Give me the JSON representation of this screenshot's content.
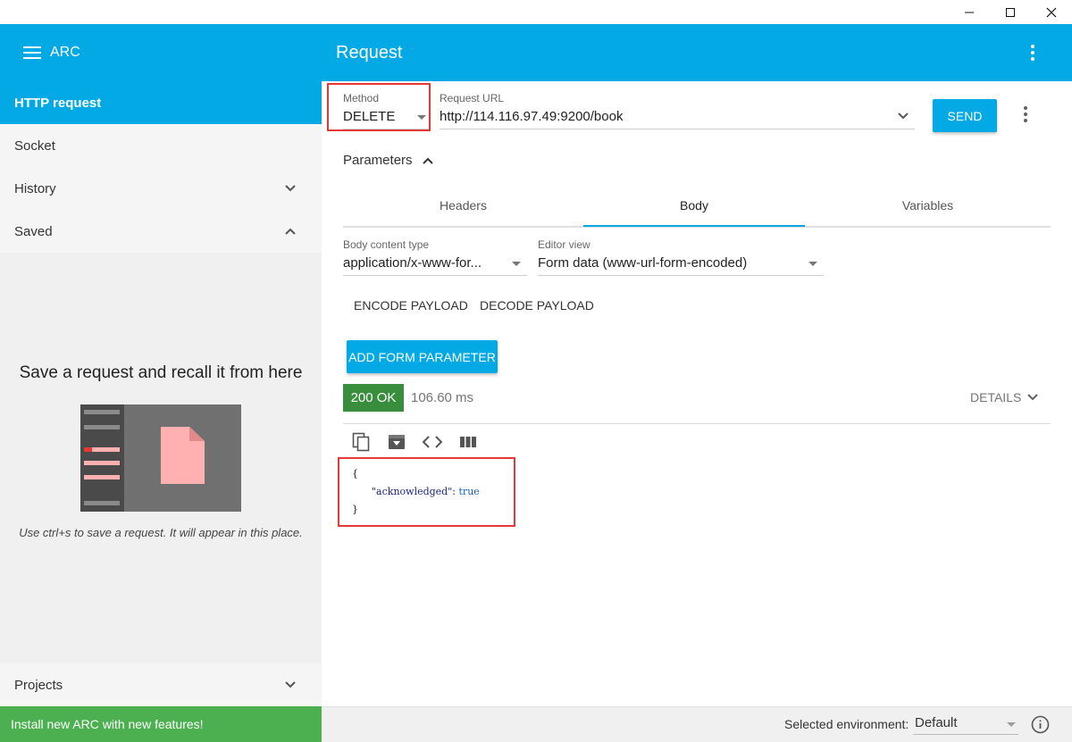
{
  "window": {
    "controls": [
      "minimize-icon",
      "maximize-icon",
      "close-icon"
    ]
  },
  "app": {
    "name": "ARC",
    "page_title": "Request"
  },
  "sidebar": {
    "items": [
      {
        "label": "HTTP request",
        "active": true
      },
      {
        "label": "Socket"
      },
      {
        "label": "History",
        "chevron": "chevron-down-icon"
      },
      {
        "label": "Saved",
        "chevron": "chevron-up-icon"
      }
    ],
    "saved_empty": {
      "title": "Save a request and recall it from here",
      "hint": "Use ctrl+s to save a request. It will appear in this place."
    },
    "projects_label": "Projects",
    "install_banner": "Install new ARC with new features!"
  },
  "request": {
    "method_label": "Method",
    "method_value": "DELETE",
    "url_label": "Request URL",
    "url_value": "http://114.116.97.49:9200/book",
    "send_label": "SEND",
    "parameters_label": "Parameters",
    "tabs": [
      {
        "label": "Headers"
      },
      {
        "label": "Body",
        "active": true
      },
      {
        "label": "Variables"
      }
    ],
    "body_content_type_label": "Body content type",
    "body_content_type_value": "application/x-www-for...",
    "editor_view_label": "Editor view",
    "editor_view_value": "Form data (www-url-form-encoded)",
    "encode_payload": "ENCODE PAYLOAD",
    "decode_payload": "DECODE PAYLOAD",
    "add_form_parameter": "ADD FORM PARAMETER"
  },
  "response": {
    "status": "200 OK",
    "time": "106.60 ms",
    "details_label": "DETAILS",
    "actions": [
      "copy-icon",
      "save-icon",
      "code-icon",
      "columns-icon"
    ],
    "json": {
      "open": "{",
      "key": "\"acknowledged\"",
      "colon": ":",
      "value": "true",
      "close": "}"
    }
  },
  "statusbar": {
    "env_label": "Selected environment:",
    "env_value": "Default"
  },
  "colors": {
    "accent": "#03a9e4",
    "status_ok": "#388e3c",
    "banner": "#4caf50",
    "highlight_box": "#e53935"
  }
}
